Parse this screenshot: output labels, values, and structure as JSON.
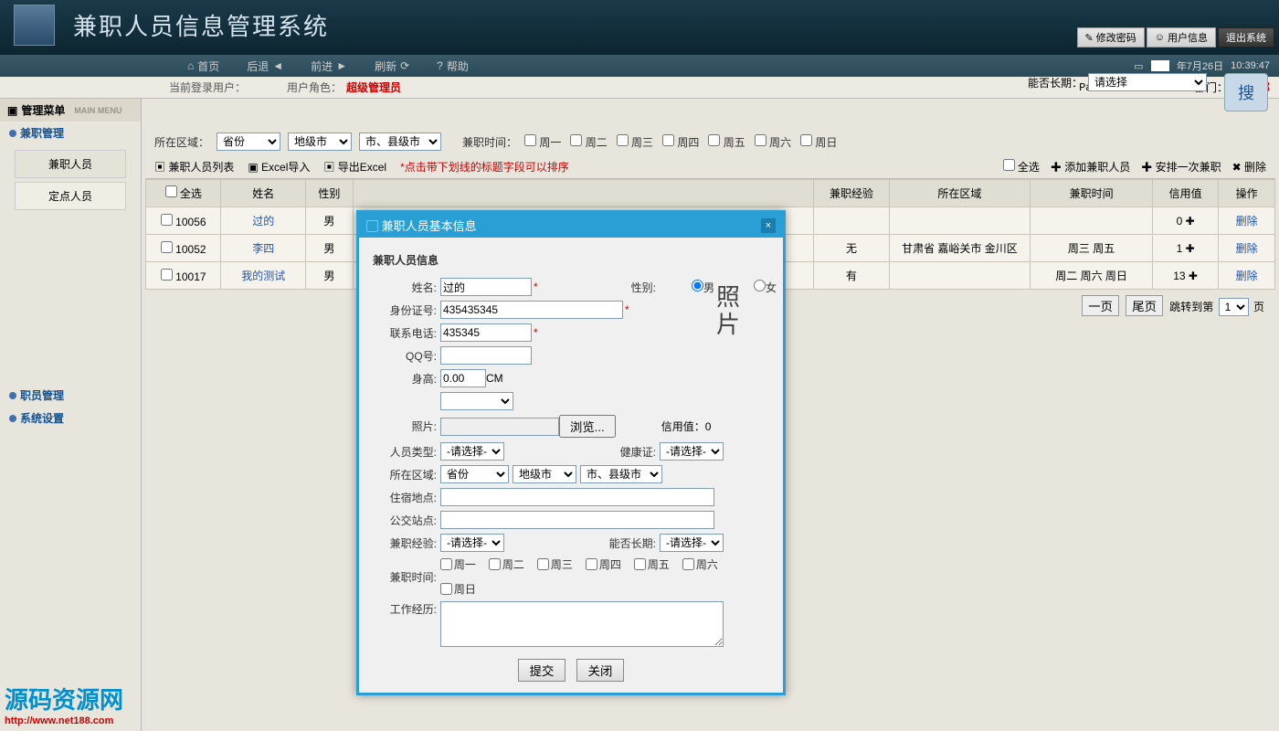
{
  "app_title": "兼职人员信息管理系统",
  "top_buttons": {
    "pwd": "修改密码",
    "user": "用户信息",
    "exit": "退出系统"
  },
  "nav": {
    "home": "首页",
    "back": "后退",
    "forward": "前进",
    "refresh": "刷新",
    "help": "帮助"
  },
  "clock": {
    "date_prefix": "年7月26日",
    "time": "10:39:47"
  },
  "infobar": {
    "login_label": "当前登录用户：",
    "role_label": "用户角色：",
    "role_value": "超级管理员",
    "brand": "Part-Time HRMS",
    "dept_label": "部门：",
    "dept_value": "企划部"
  },
  "sidebar": {
    "menu_title": "管理菜单",
    "menu_sub": "MAIN MENU",
    "group1": "兼职管理",
    "item_parttime": "兼职人员",
    "item_fixed": "定点人员",
    "group_emp": "职员管理",
    "group_sys": "系统设置"
  },
  "filter": {
    "area_label": "所在区域：",
    "province": "省份",
    "city": "地级市",
    "county": "市、县级市",
    "time_label": "兼职时间：",
    "days": [
      "周一",
      "周二",
      "周三",
      "周四",
      "周五",
      "周六",
      "周日"
    ],
    "longterm_label": "能否长期：",
    "select_please": "请选择",
    "search": "搜"
  },
  "toolbar": {
    "list": "兼职人员列表",
    "import": "Excel导入",
    "export": "导出Excel",
    "hint": "*点击带下划线的标题字段可以排序",
    "select_all": "全选",
    "add": "添加兼职人员",
    "arrange": "安排一次兼职",
    "delete": "删除"
  },
  "table": {
    "headers": {
      "sel": "全选",
      "name": "姓名",
      "gender": "性别",
      "exp": "兼职经验",
      "area": "所在区域",
      "time": "兼职时间",
      "credit": "信用值",
      "op": "操作"
    },
    "rows": [
      {
        "id": "10056",
        "name": "过的",
        "gender": "男",
        "exp": "",
        "area": "",
        "time": "",
        "credit": "0",
        "op": "删除"
      },
      {
        "id": "10052",
        "name": "李四",
        "gender": "男",
        "exp": "无",
        "area": "甘肃省 嘉峪关市 金川区",
        "time": "周三 周五",
        "credit": "1",
        "op": "删除"
      },
      {
        "id": "10017",
        "name": "我的测试",
        "gender": "男",
        "exp": "有",
        "area": "",
        "time": "周二 周六 周日",
        "credit": "13",
        "op": "删除"
      }
    ]
  },
  "pager": {
    "prev": "一页",
    "last": "尾页",
    "jump_label": "跳转到第",
    "page": "1",
    "page_suffix": "页"
  },
  "dialog": {
    "title": "兼职人员基本信息",
    "section": "兼职人员信息",
    "labels": {
      "name": "姓名:",
      "gender": "性别:",
      "male": "男",
      "female": "女",
      "idcard": "身份证号:",
      "phone": "联系电话:",
      "qq": "QQ号:",
      "height": "身高:",
      "cm": "CM",
      "photo": "照片:",
      "browse": "浏览...",
      "credit": "信用值：",
      "credit_val": "0",
      "ptype": "人员类型:",
      "health": "健康证:",
      "area": "所在区域:",
      "addr": "住宿地点:",
      "bus": "公交站点:",
      "exp": "兼职经验:",
      "longterm": "能否长期:",
      "time": "兼职时间:",
      "workexp": "工作经历:",
      "select": "-请选择-",
      "province": "省份",
      "city": "地级市",
      "county": "市、县级市"
    },
    "values": {
      "name": "过的",
      "idcard": "435435345",
      "phone": "435345",
      "height": "0.00"
    },
    "days": [
      "周一",
      "周二",
      "周三",
      "周四",
      "周五",
      "周六",
      "周日"
    ],
    "photo_text_1": "照",
    "photo_text_2": "片",
    "submit": "提交",
    "close": "关闭"
  },
  "watermark": {
    "name": "源码资源网",
    "url": "http://www.net188.com"
  }
}
